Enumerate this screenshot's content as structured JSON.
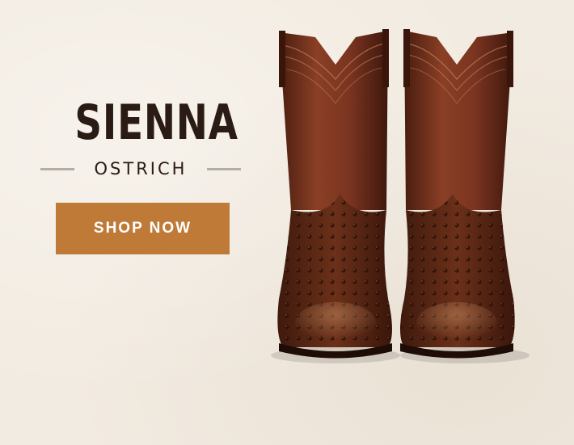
{
  "banner": {
    "title": "SIENNA",
    "subtitle": "OSTRICH",
    "cta_label": "SHOP NOW",
    "image_subject": "pair of brown ostrich cowboy boots",
    "colors": {
      "background": "#f2ebe1",
      "title_text": "#2a1b14",
      "cta_background": "#c07a38",
      "cta_text": "#ffffff",
      "boot_leather": "#7a3420",
      "ostrich_vamp": "#5b2a16"
    }
  }
}
